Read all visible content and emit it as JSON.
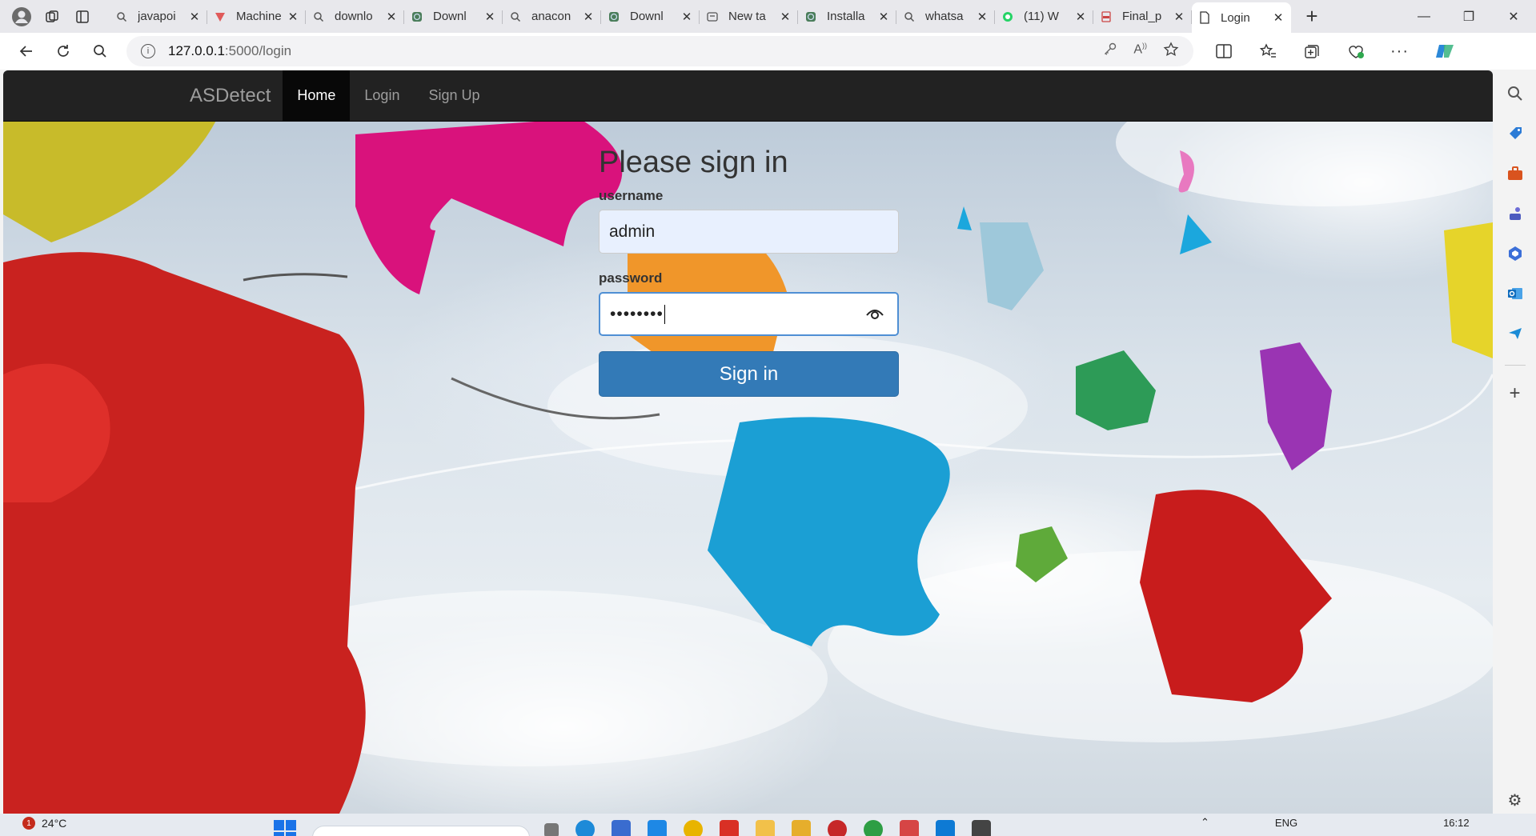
{
  "browser": {
    "tabs": [
      {
        "title": "javapoi",
        "icon": "search-icon"
      },
      {
        "title": "Machine",
        "icon": "vercel-icon"
      },
      {
        "title": "downlo",
        "icon": "search-icon"
      },
      {
        "title": "Downl",
        "icon": "page-icon"
      },
      {
        "title": "anacon",
        "icon": "search-icon"
      },
      {
        "title": "Downl",
        "icon": "page-icon"
      },
      {
        "title": "New ta",
        "icon": "newtab-icon"
      },
      {
        "title": "Installa",
        "icon": "page-icon"
      },
      {
        "title": "whatsa",
        "icon": "search-icon"
      },
      {
        "title": "(11) W",
        "icon": "whatsapp-icon"
      },
      {
        "title": "Final_p",
        "icon": "pdf-icon"
      },
      {
        "title": "Login",
        "icon": "page-icon",
        "active": true
      }
    ],
    "url_host": "127.0.0.1",
    "url_path": ":5000/login"
  },
  "navbar": {
    "brand": "ASDetect",
    "links": [
      "Home",
      "Login",
      "Sign Up"
    ],
    "active_link": "Home"
  },
  "form": {
    "heading": "Please sign in",
    "username_label": "username",
    "username_value": "admin",
    "password_label": "password",
    "password_value": "••••••••",
    "submit_label": "Sign in"
  },
  "taskbar": {
    "weather_temp": "24°C",
    "weather_badge": "1",
    "language": "ENG",
    "time": "16:12"
  },
  "colors": {
    "navbar_bg": "#222222",
    "primary_button": "#337ab7",
    "autofill_bg": "#e8f0fe"
  }
}
